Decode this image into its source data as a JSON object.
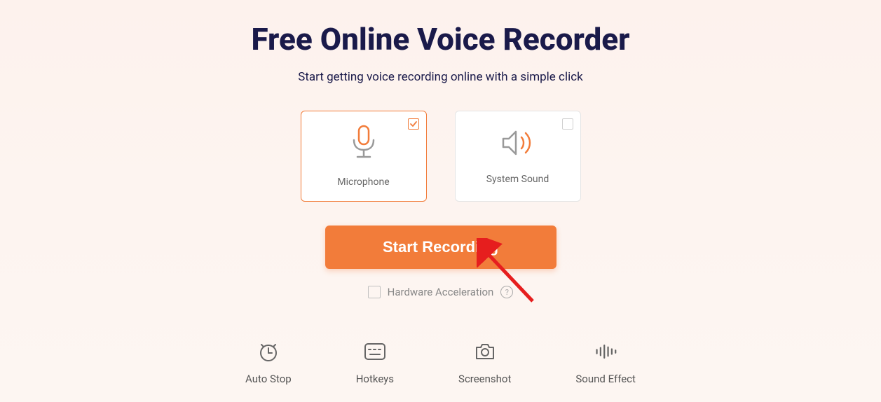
{
  "header": {
    "title": "Free Online Voice Recorder",
    "subtitle": "Start getting voice recording online with a simple click"
  },
  "sources": {
    "microphone": {
      "label": "Microphone",
      "selected": true
    },
    "system_sound": {
      "label": "System Sound",
      "selected": false
    }
  },
  "actions": {
    "start_label": "Start Recording"
  },
  "options": {
    "hardware_accel_label": "Hardware Acceleration",
    "hardware_accel_checked": false
  },
  "features": [
    {
      "id": "auto-stop",
      "label": "Auto Stop"
    },
    {
      "id": "hotkeys",
      "label": "Hotkeys"
    },
    {
      "id": "screenshot",
      "label": "Screenshot"
    },
    {
      "id": "sound-effect",
      "label": "Sound Effect"
    }
  ]
}
